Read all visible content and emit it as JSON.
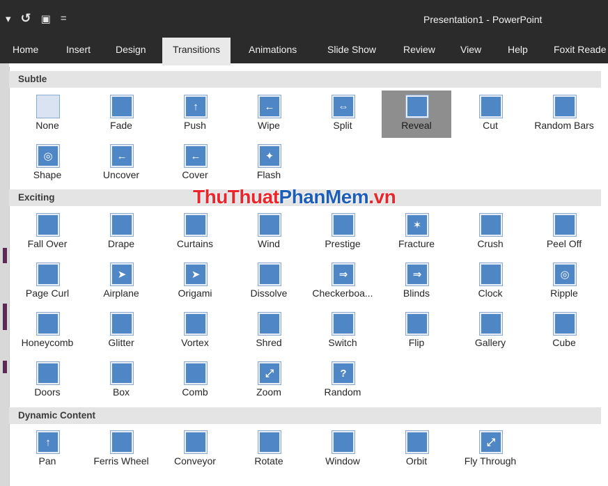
{
  "qat": {
    "customize_arrow": "▾",
    "undo_icon": "↺",
    "present_icon": "▣",
    "more_icon": "="
  },
  "window": {
    "title": "Presentation1  -  PowerPoint"
  },
  "tabs": [
    {
      "label": "Home"
    },
    {
      "label": "Insert"
    },
    {
      "label": "Design"
    },
    {
      "label": "Transitions"
    },
    {
      "label": "Animations"
    },
    {
      "label": "Slide Show"
    },
    {
      "label": "Review"
    },
    {
      "label": "View"
    },
    {
      "label": "Help"
    },
    {
      "label": "Foxit Reade"
    }
  ],
  "sections": {
    "subtle": "Subtle",
    "exciting": "Exciting",
    "dynamic": "Dynamic Content"
  },
  "watermark": {
    "part1": "ThuThuat",
    "part2": "PhanMem",
    "part3": ".vn"
  },
  "subtle": [
    {
      "label": "None",
      "icon": "none-icon"
    },
    {
      "label": "Fade",
      "icon": "fade-icon"
    },
    {
      "label": "Push",
      "icon": "push-icon"
    },
    {
      "label": "Wipe",
      "icon": "wipe-icon"
    },
    {
      "label": "Split",
      "icon": "split-icon"
    },
    {
      "label": "Reveal",
      "icon": "reveal-icon"
    },
    {
      "label": "Cut",
      "icon": "cut-icon"
    },
    {
      "label": "Random Bars",
      "icon": "random-bars-icon"
    },
    {
      "label": "Shape",
      "icon": "shape-icon"
    },
    {
      "label": "Uncover",
      "icon": "uncover-icon"
    },
    {
      "label": "Cover",
      "icon": "cover-icon"
    },
    {
      "label": "Flash",
      "icon": "flash-icon"
    }
  ],
  "exciting": [
    {
      "label": "Fall Over",
      "icon": "fall-over-icon"
    },
    {
      "label": "Drape",
      "icon": "drape-icon"
    },
    {
      "label": "Curtains",
      "icon": "curtains-icon"
    },
    {
      "label": "Wind",
      "icon": "wind-icon"
    },
    {
      "label": "Prestige",
      "icon": "prestige-icon"
    },
    {
      "label": "Fracture",
      "icon": "fracture-icon"
    },
    {
      "label": "Crush",
      "icon": "crush-icon"
    },
    {
      "label": "Peel Off",
      "icon": "peel-off-icon"
    },
    {
      "label": "Page Curl",
      "icon": "page-curl-icon"
    },
    {
      "label": "Airplane",
      "icon": "airplane-icon"
    },
    {
      "label": "Origami",
      "icon": "origami-icon"
    },
    {
      "label": "Dissolve",
      "icon": "dissolve-icon"
    },
    {
      "label": "Checkerboa...",
      "icon": "checkerboard-icon"
    },
    {
      "label": "Blinds",
      "icon": "blinds-icon"
    },
    {
      "label": "Clock",
      "icon": "clock-icon"
    },
    {
      "label": "Ripple",
      "icon": "ripple-icon"
    },
    {
      "label": "Honeycomb",
      "icon": "honeycomb-icon"
    },
    {
      "label": "Glitter",
      "icon": "glitter-icon"
    },
    {
      "label": "Vortex",
      "icon": "vortex-icon"
    },
    {
      "label": "Shred",
      "icon": "shred-icon"
    },
    {
      "label": "Switch",
      "icon": "switch-icon"
    },
    {
      "label": "Flip",
      "icon": "flip-icon"
    },
    {
      "label": "Gallery",
      "icon": "gallery-icon"
    },
    {
      "label": "Cube",
      "icon": "cube-icon"
    },
    {
      "label": "Doors",
      "icon": "doors-icon"
    },
    {
      "label": "Box",
      "icon": "box-icon"
    },
    {
      "label": "Comb",
      "icon": "comb-icon"
    },
    {
      "label": "Zoom",
      "icon": "zoom-icon"
    },
    {
      "label": "Random",
      "icon": "random-icon"
    }
  ],
  "dynamic": [
    {
      "label": "Pan",
      "icon": "pan-icon"
    },
    {
      "label": "Ferris Wheel",
      "icon": "ferris-wheel-icon"
    },
    {
      "label": "Conveyor",
      "icon": "conveyor-icon"
    },
    {
      "label": "Rotate",
      "icon": "rotate-icon"
    },
    {
      "label": "Window",
      "icon": "window-icon"
    },
    {
      "label": "Orbit",
      "icon": "orbit-icon"
    },
    {
      "label": "Fly Through",
      "icon": "fly-through-icon"
    }
  ],
  "selected_transition": "Reveal",
  "colors": {
    "accent": "#4f86c6",
    "titlebar": "#2b2b2b",
    "selected": "#8e8e8e"
  }
}
